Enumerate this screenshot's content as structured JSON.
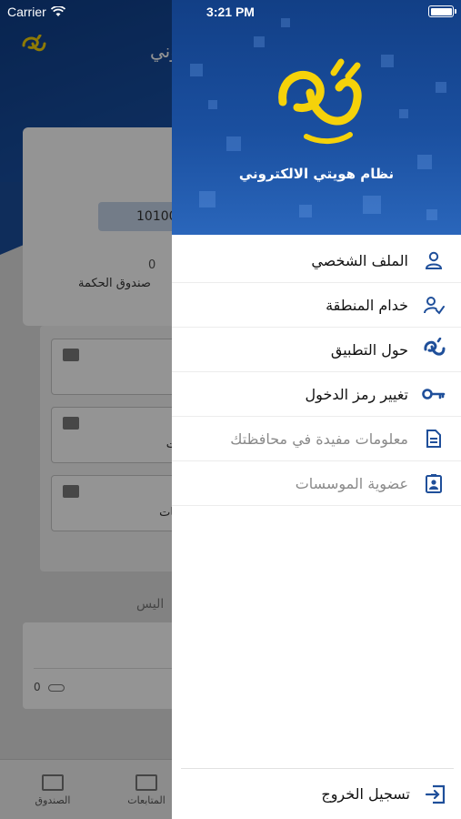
{
  "status_bar": {
    "carrier": "Carrier",
    "time": "3:21 PM"
  },
  "background": {
    "header_title": "وني",
    "fund_number": "10100",
    "fund_count": "0",
    "fund_label": "صندوق الحكمة",
    "tile_labels": [
      "",
      "ت",
      "بات"
    ],
    "section_title": "اليس",
    "message_count": "0",
    "tabs": [
      {
        "label": "الصندوق",
        "icon": "box-icon"
      },
      {
        "label": "المتابعات",
        "icon": "mail-icon"
      }
    ]
  },
  "drawer": {
    "caption": "نظام هويتي الالكتروني",
    "menu": [
      {
        "label": "الملف الشخصي",
        "icon": "user-icon",
        "enabled": true
      },
      {
        "label": "خدام المنطقة",
        "icon": "user-check-icon",
        "enabled": true
      },
      {
        "label": "حول التطبيق",
        "icon": "app-logo-icon",
        "enabled": true
      },
      {
        "label": "تغيير رمز الدخول",
        "icon": "key-icon",
        "enabled": true
      },
      {
        "label": "معلومات مفيدة في محافظتك",
        "icon": "document-icon",
        "enabled": false
      },
      {
        "label": "عضوية الموسسات",
        "icon": "id-badge-icon",
        "enabled": false
      }
    ],
    "logout_label": "تسجيل الخروج"
  },
  "colors": {
    "primary": "#1a4f9f",
    "icon": "#1f4f9a",
    "logo": "#f5d20a"
  }
}
